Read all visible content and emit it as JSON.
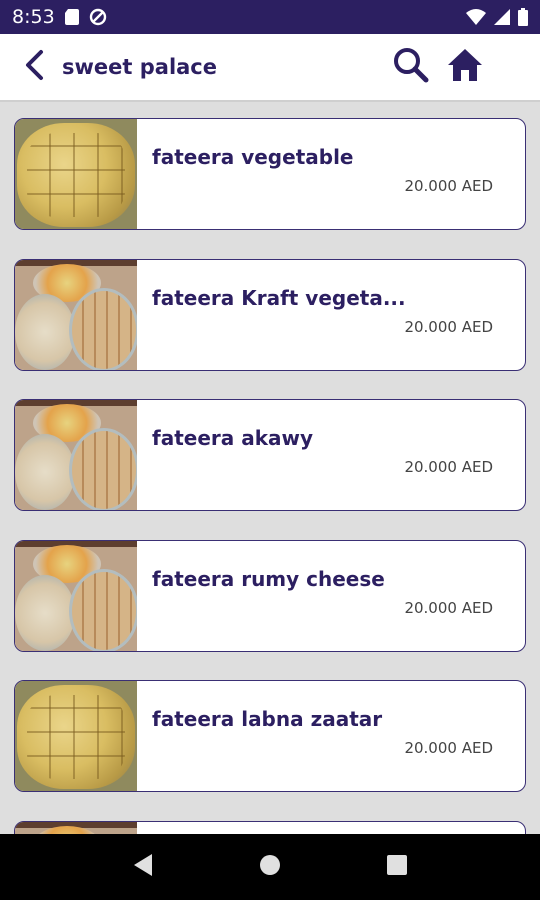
{
  "status_bar": {
    "time": "8:53"
  },
  "app_bar": {
    "title": "sweet palace"
  },
  "items": [
    {
      "name": "fateera vegetable",
      "price": "20.000 AED",
      "image": "flatbread"
    },
    {
      "name": "fateera Kraft vegeta...",
      "price": "20.000 AED",
      "image": "trays"
    },
    {
      "name": "fateera akawy",
      "price": "20.000 AED",
      "image": "trays"
    },
    {
      "name": "fateera rumy cheese",
      "price": "20.000 AED",
      "image": "trays"
    },
    {
      "name": "fateera labna zaatar",
      "price": "20.000 AED",
      "image": "flatbread"
    }
  ],
  "colors": {
    "primary": "#2c1f61",
    "background": "#dedede"
  }
}
